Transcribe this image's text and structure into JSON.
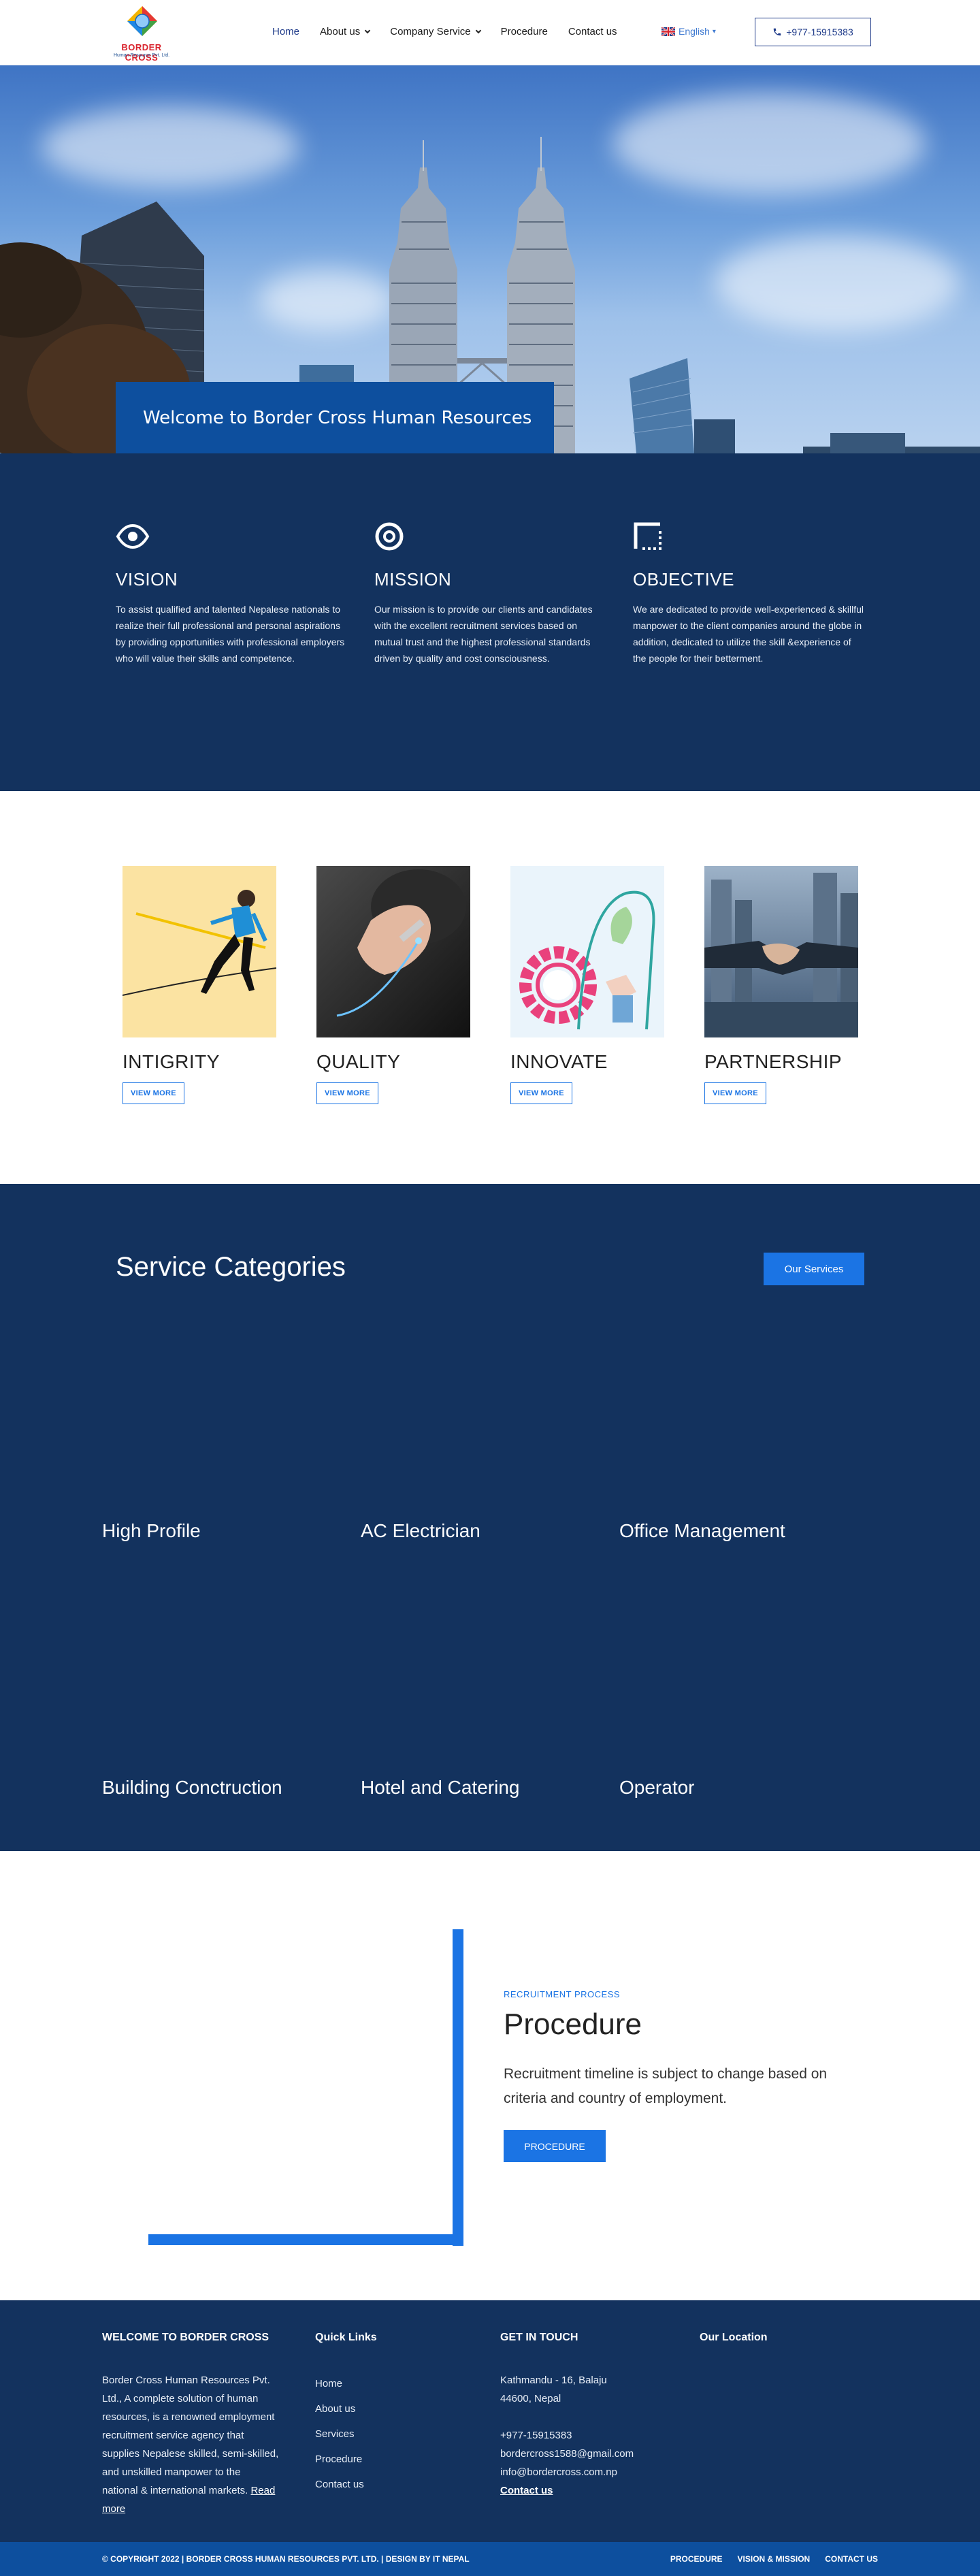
{
  "header": {
    "logo_text": "BORDER CROSS",
    "logo_subtext": "Human Resource Pvt. Ltd.",
    "nav": [
      {
        "label": "Home",
        "active": true,
        "dropdown": false
      },
      {
        "label": "About us",
        "active": false,
        "dropdown": true
      },
      {
        "label": "Company Service",
        "active": false,
        "dropdown": true
      },
      {
        "label": "Procedure",
        "active": false,
        "dropdown": false
      },
      {
        "label": "Contact us",
        "active": false,
        "dropdown": false
      }
    ],
    "language": "English",
    "phone": "+977-15915383"
  },
  "hero": {
    "caption": "Welcome to Border Cross Human Resources"
  },
  "vision": [
    {
      "icon": "eye-icon",
      "title": "VISION",
      "text": "To assist qualified and talented Nepalese nationals to realize their full professional and personal aspirations by providing opportunities with professional employers who will value their skills and competence."
    },
    {
      "icon": "target-icon",
      "title": "MISSION",
      "text": "Our mission is to provide our clients and candidates with the excellent recruitment services based on mutual trust and the highest professional standards driven by quality and cost consciousness."
    },
    {
      "icon": "corner-frame-icon",
      "title": "OBJECTIVE",
      "text": "We are dedicated to provide well-experienced & skillful manpower to the client companies around the globe in addition, dedicated to utilize the skill &experience of the people for their betterment."
    }
  ],
  "values": [
    {
      "title": "INTIGRITY",
      "button": "VIEW MORE",
      "image": "tightrope-illustration"
    },
    {
      "title": "QUALITY",
      "button": "VIEW MORE",
      "image": "hand-drawing-graph"
    },
    {
      "title": "INNOVATE",
      "button": "VIEW MORE",
      "image": "gear-lightbulb-illustration"
    },
    {
      "title": "PARTNERSHIP",
      "button": "VIEW MORE",
      "image": "handshake-city"
    }
  ],
  "services": {
    "title": "Service Categories",
    "button": "Our Services",
    "items": [
      "High Profile",
      "AC Electrician",
      "Office Management",
      "Building Conctruction",
      "Hotel and Catering",
      "Operator"
    ]
  },
  "procedure": {
    "kicker": "RECRUITMENT PROCESS",
    "title": "Procedure",
    "text": "Recruitment timeline is subject to change based on criteria and country of employment.",
    "button": "PROCEDURE"
  },
  "footer": {
    "about_heading": "WELCOME TO BORDER CROSS",
    "about_text": "Border Cross Human Resources Pvt. Ltd., A complete solution of human resources, is a renowned employment recruitment service agency that supplies Nepalese skilled, semi-skilled, and unskilled manpower to the national & international markets.",
    "read_more": "Read more",
    "links_heading": "Quick Links",
    "links": [
      "Home",
      "About us",
      "Services",
      "Procedure",
      "Contact us"
    ],
    "contact_heading": "GET IN TOUCH",
    "address_line1": "Kathmandu - 16, Balaju",
    "address_line2": "44600, Nepal",
    "phone": "+977-15915383",
    "email": "bordercross1588@gmail.com",
    "email2": "info@bordercross.com.np",
    "contact_link": "Contact us",
    "location_heading": "Our Location",
    "copyright": "© COPYRIGHT 2022 | BORDER CROSS HUMAN RESOURCES PVT. LTD. | DESIGN BY IT NEPAL",
    "bottom_links": [
      "PROCEDURE",
      "VISION & MISSION",
      "CONTACT US"
    ]
  },
  "colors": {
    "navy": "#13325e",
    "brand_blue": "#0d4f9e",
    "accent": "#1b74e4"
  }
}
